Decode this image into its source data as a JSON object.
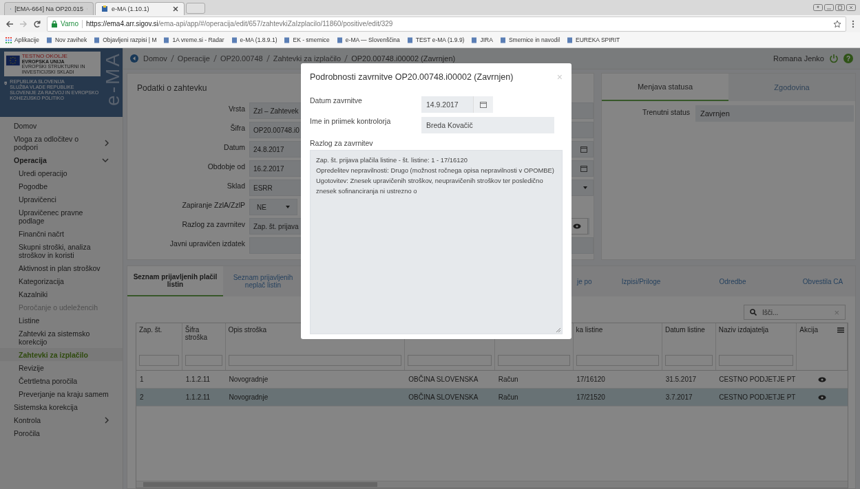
{
  "browser": {
    "tabs": [
      {
        "title": "[EMA-664] Na OP20.015",
        "selected": false
      },
      {
        "title": "e-MA (1.10.1)",
        "selected": true
      }
    ],
    "secure_label": "Varno",
    "url_host": "https://ema4.arr.sigov.si",
    "url_path": "/ema-api/app/#/operacija/edit/657/zahtevkiZaIzplacilo/11860/positive/edit/329",
    "bookmarks": [
      "Aplikacije",
      "Nov zavihek",
      "Objavljeni razpisi | M",
      "1A vreme.si - Radar",
      "e-MA (1.8.9.1)",
      "EK - smernice",
      "e-MA — Slovenščina",
      "TEST e-MA (1.9.9)",
      "JIRA",
      "Smernice in navodil",
      "EUREKA SPIRIT"
    ]
  },
  "logo": {
    "badge": "TESTNO OKOLJE",
    "union": "EVROPSKA UNIJA",
    "funds": "EVROPSKI STRUKTURNI IN INVESTICIJSKI SKLADI",
    "republic": "REPUBLIKA SLOVENIJA",
    "office": "SLUŽBA VLADE REPUBLIKE SLOVENIJE ZA RAZVOJ IN EVROPSKO KOHEZIJSKO POLITIKO",
    "app_name": "e-MA"
  },
  "sidebar": {
    "items": [
      {
        "label": "Domov",
        "selected": false
      },
      {
        "label": "Vloga za odločitev o podpori",
        "selected": false,
        "expanded": false
      },
      {
        "label": "Operacija",
        "selected": false,
        "expanded": true,
        "children": [
          {
            "label": "Uredi operacijo",
            "selected": false,
            "disabled": false
          },
          {
            "label": "Pogodbe",
            "selected": false,
            "disabled": false
          },
          {
            "label": "Upravičenci",
            "selected": false,
            "disabled": false
          },
          {
            "label": "Upravičenec pravne podlage",
            "selected": false,
            "disabled": false
          },
          {
            "label": "Finančni načrt",
            "selected": false,
            "disabled": false
          },
          {
            "label": "Skupni stroški, analiza stroškov in koristi",
            "selected": false,
            "disabled": false
          },
          {
            "label": "Aktivnost in plan stroškov",
            "selected": false,
            "disabled": false
          },
          {
            "label": "Kategorizacija",
            "selected": false,
            "disabled": false
          },
          {
            "label": "Kazalniki",
            "selected": false,
            "disabled": false
          },
          {
            "label": "Poročanje o udeležencih",
            "selected": false,
            "disabled": true
          },
          {
            "label": "Listine",
            "selected": false,
            "disabled": false
          },
          {
            "label": "Zahtevki za sistemsko korekcijo",
            "selected": false,
            "disabled": false
          },
          {
            "label": "Zahtevki za izplačilo",
            "selected": true,
            "disabled": false
          },
          {
            "label": "Revizije",
            "selected": false,
            "disabled": false
          },
          {
            "label": "Četrtletna poročila",
            "selected": false,
            "disabled": false
          },
          {
            "label": "Preverjanje na kraju samem",
            "selected": false,
            "disabled": false
          }
        ]
      },
      {
        "label": "Sistemska korekcija",
        "selected": false
      },
      {
        "label": "Kontrola",
        "selected": false,
        "expanded": false
      },
      {
        "label": "Poročila",
        "selected": false
      }
    ]
  },
  "breadcrumb": [
    "Domov",
    "Operacije",
    "OP20.00748",
    "Zahtevki za izplačilo",
    "OP20.00748.i00002 (Zavrnjen)"
  ],
  "user": {
    "name": "Romana Jenko",
    "help": "?"
  },
  "request": {
    "title": "Podatki o zahtevku",
    "fields": [
      {
        "label": "Vrsta",
        "value": "Zzl – Zahtevek",
        "kind": "text"
      },
      {
        "label": "Šifra",
        "value": "OP20.00748.i0",
        "kind": "text"
      },
      {
        "label": "Datum",
        "value": "24.8.2017",
        "kind": "date"
      },
      {
        "label": "Obdobje od",
        "value": "16.2.2017",
        "kind": "date"
      },
      {
        "label": "Sklad",
        "value": "ESRR",
        "kind": "select"
      },
      {
        "label": "Zapiranje ZzlA/ZzlP",
        "value": "NE",
        "kind": "small-select"
      },
      {
        "label": "Razlog za zavrnitev",
        "value": "Zap. št. prijava",
        "kind": "view"
      },
      {
        "label": "Javni upravičen izdatek",
        "kind": "text"
      }
    ]
  },
  "status_panel": {
    "tabs": [
      {
        "label": "Menjava statusa",
        "selected": true
      },
      {
        "label": "Zgodovina",
        "selected": false
      }
    ],
    "status_label": "Trenutni status",
    "status_value": "Zavrnjen"
  },
  "lower_tabs": [
    {
      "label": "Seznam prijavljenih plačil listin",
      "selected": true
    },
    {
      "label": "Seznam prijavljenih neplač listin",
      "selected": false
    },
    {
      "label": "je po",
      "selected": false,
      "gap_before": true
    },
    {
      "label": "Izpisi/Priloge",
      "selected": false
    },
    {
      "label": "Odredbe",
      "selected": false
    },
    {
      "label": "Obvestila CA",
      "selected": false
    }
  ],
  "search": {
    "placeholder": "Išči...",
    "clear": "×"
  },
  "table": {
    "columns": [
      {
        "label": "Zap. št."
      },
      {
        "label": "Šifra stroška"
      },
      {
        "label": "Opis stroška"
      },
      {},
      {},
      {
        "label": "ka listine"
      },
      {
        "label": "Datum listine"
      },
      {
        "label": "Naziv izdajatelja"
      },
      {
        "label": "Akcija",
        "kind": "action"
      }
    ],
    "rows": [
      {
        "selected": false,
        "cells": [
          "1",
          "1.1.2.11",
          "Novogradnje",
          "OBČINA SLOVENSKA",
          "Račun",
          "17/16120",
          "31.5.2017",
          "CESTNO PODJETJE PT"
        ]
      },
      {
        "selected": true,
        "cells": [
          "2",
          "1.1.2.11",
          "Novogradnje",
          "OBČINA SLOVENSKA",
          "Račun",
          "17/21520",
          "3.7.2017",
          "CESTNO PODJETJE PT"
        ]
      }
    ]
  },
  "modal": {
    "title": "Podrobnosti zavrnitve OP20.00748.i00002 (Zavrnjen)",
    "close": "×",
    "date_label": "Datum zavrnitve",
    "date_value": "14.9.2017",
    "controller_label": "Ime in priimek kontrolorja",
    "controller_value": "Breda Kovačič",
    "reason_label": "Razlog za zavrnitev",
    "reason_text": "Zap. št. prijava plačila listine - št. listine: 1 - 17/16120\nOpredelitev nepravilnosti: Drugo (možnost ročnega opisa nepravilnosti v OPOMBE)\nUgotovitev: Znesek upravičenih stroškov, neupravičenih stroškov ter posledično znesek sofinanciranja ni ustrezno o"
  }
}
